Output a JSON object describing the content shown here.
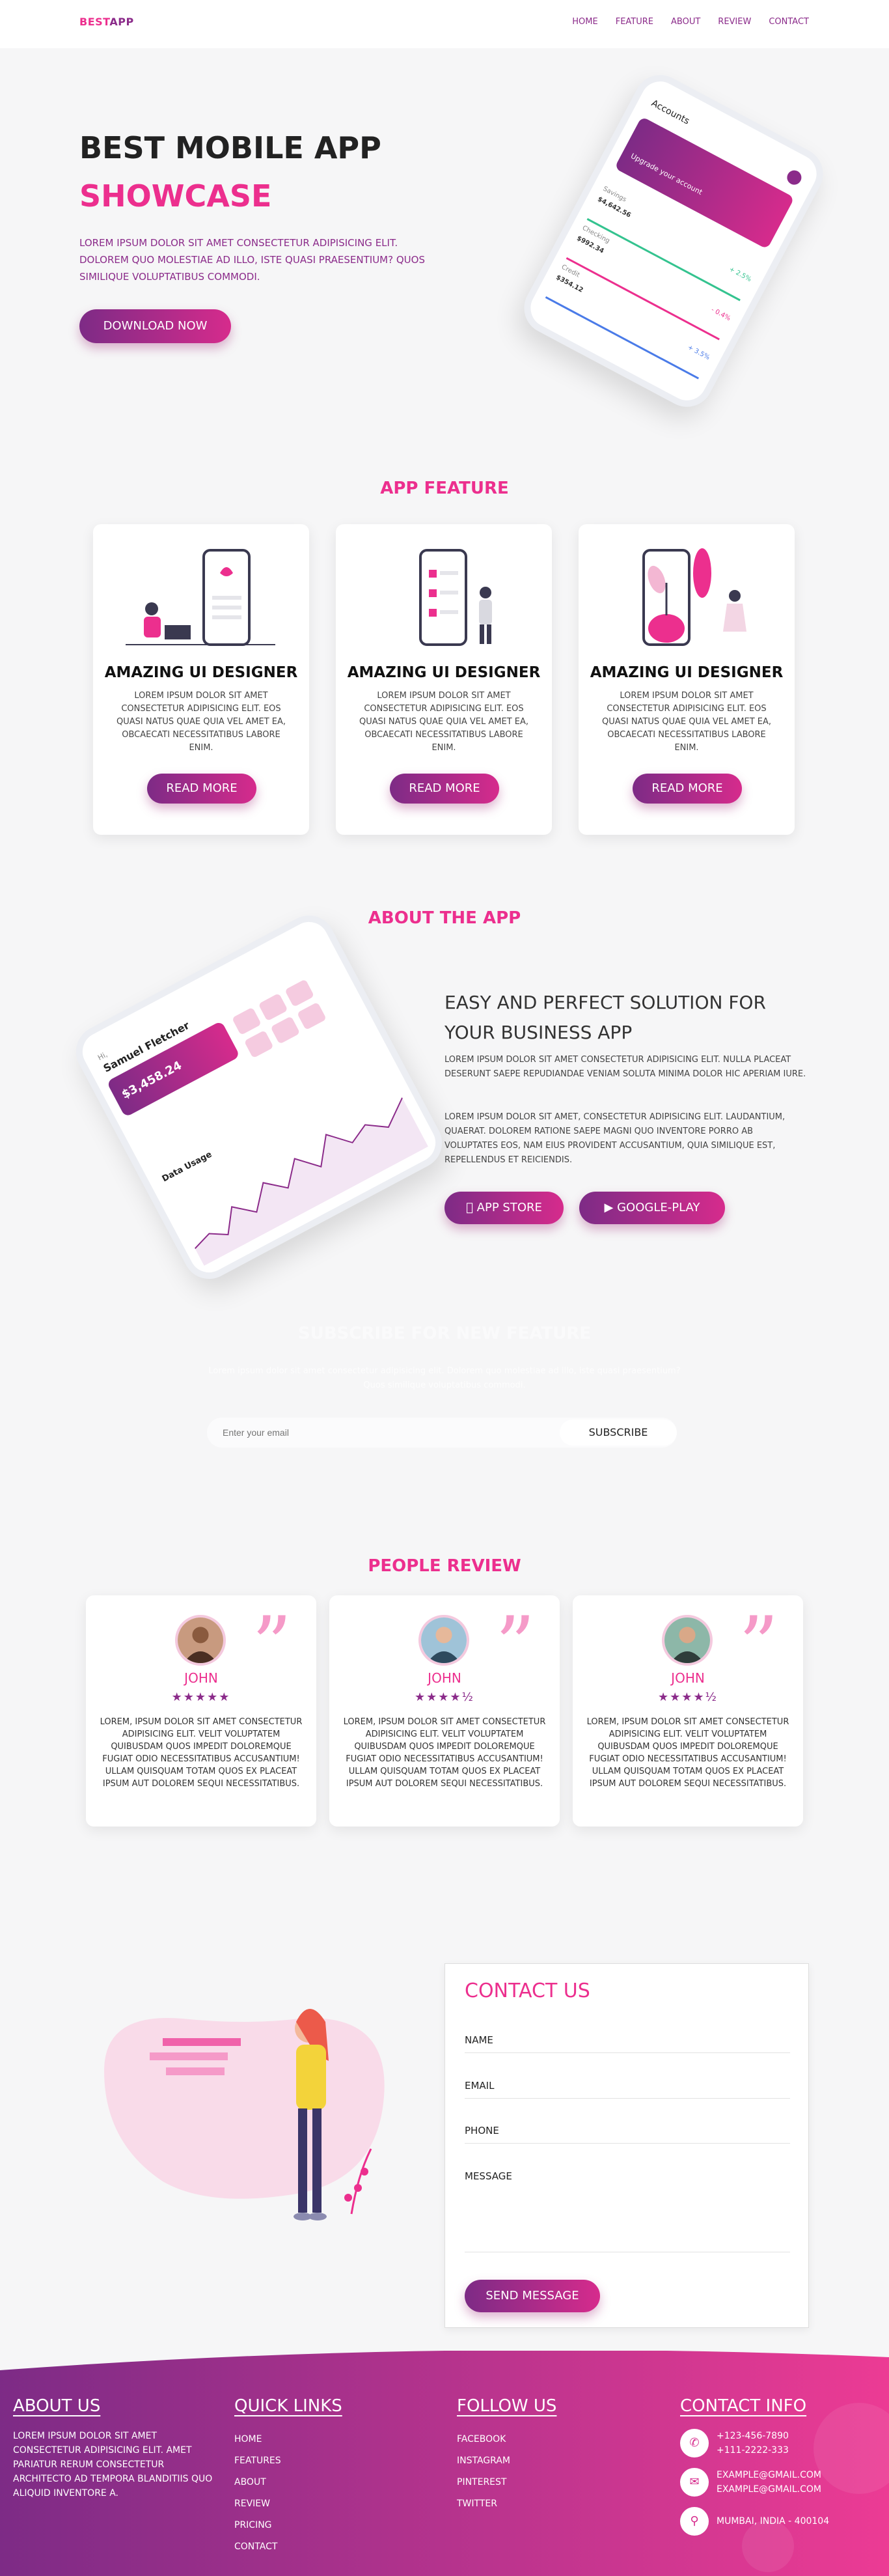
{
  "header": {
    "logo_a": "BEST",
    "logo_b": "APP",
    "nav": [
      "HOME",
      "FEATURE",
      "ABOUT",
      "REVIEW",
      "CONTACT"
    ]
  },
  "hero": {
    "title1": "BEST MOBILE APP",
    "title2": "SHOWCASE",
    "text": "Lorem ipsum dolor sit amet consectetur adipisicing elit. Dolorem quo molestiae ad illo, iste quasi praesentium? Quos similique voluptatibus commodi.",
    "button": "DOWNLOAD NOW",
    "phone": {
      "heading": "Accounts",
      "card": "Upgrade your account",
      "rows": [
        {
          "label": "Savings",
          "value": "$4,642.56",
          "delta": "+ 2.5%"
        },
        {
          "label": "Checking",
          "value": "$992.34",
          "delta": "- 0.4%"
        },
        {
          "label": "Credit",
          "value": "$354.12",
          "delta": "+ 3.5%"
        }
      ]
    }
  },
  "features": {
    "title": "APP FEATURE",
    "cards": [
      {
        "title": "AMAZING UI DESIGNER",
        "text": "Lorem ipsum dolor sit amet consectetur adipisicing elit. Eos quasi natus quae quia vel amet ea, obcaecati necessitatibus labore enim.",
        "button": "READ MORE"
      },
      {
        "title": "AMAZING UI DESIGNER",
        "text": "Lorem ipsum dolor sit amet consectetur adipisicing elit. Eos quasi natus quae quia vel amet ea, obcaecati necessitatibus labore enim.",
        "button": "READ MORE"
      },
      {
        "title": "AMAZING UI DESIGNER",
        "text": "Lorem ipsum dolor sit amet consectetur adipisicing elit. Eos quasi natus quae quia vel amet ea, obcaecati necessitatibus labore enim.",
        "button": "READ MORE"
      }
    ]
  },
  "about": {
    "title": "ABOUT THE APP",
    "heading": "EASY AND PERFECT SOLUTION FOR YOUR BUSINESS APP",
    "p1": "Lorem ipsum dolor sit amet consectetur adipisicing elit. Nulla placeat deserunt saepe repudiandae veniam soluta minima dolor hic aperiam iure.",
    "p2": "Lorem ipsum dolor sit amet, consectetur adipisicing elit. Laudantium, quaerat. Dolorem ratione saepe magni quo inventore porro ab voluptates eos, nam eius provident accusantium, quia similique est, repellendus et reiciendis.",
    "appstore": "APP STORE",
    "gplay": "GOOGLE-PLAY",
    "phone": {
      "greet": "Hi,",
      "name": "Samuel Fletcher",
      "balance": "$3,458.24",
      "chart": "Data Usage"
    }
  },
  "subscribe": {
    "title": "SUBSCRIBE FOR NEW FEATURE",
    "text": "Lorem ipsum dolor sit amet consectetur adipisicing elit. Dolorem quo molestiae ad illo, iste quasi praesentium? Quos similique voluptatibus commodi.",
    "placeholder": "Enter your email",
    "button": "SUBSCRIBE"
  },
  "review": {
    "title": "PEOPLE REVIEW",
    "cards": [
      {
        "name": "JOHN",
        "stars": "★★★★★",
        "text": "Lorem, ipsum dolor sit amet consectetur adipisicing elit. Velit voluptatem quibusdam quos impedit doloremque fugiat odio necessitatibus accusantium! Ullam quisquam totam quos ex placeat ipsum aut dolorem sequi necessitatibus."
      },
      {
        "name": "JOHN",
        "stars": "★★★★½",
        "text": "Lorem, ipsum dolor sit amet consectetur adipisicing elit. Velit voluptatem quibusdam quos impedit doloremque fugiat odio necessitatibus accusantium! Ullam quisquam totam quos ex placeat ipsum aut dolorem sequi necessitatibus."
      },
      {
        "name": "JOHN",
        "stars": "★★★★½",
        "text": "Lorem, ipsum dolor sit amet consectetur adipisicing elit. Velit voluptatem quibusdam quos impedit doloremque fugiat odio necessitatibus accusantium! Ullam quisquam totam quos ex placeat ipsum aut dolorem sequi necessitatibus."
      }
    ]
  },
  "contact": {
    "title": "CONTACT US",
    "fields": [
      "NAME",
      "EMAIL",
      "PHONE",
      "MESSAGE"
    ],
    "button": "SEND MESSAGE"
  },
  "footer": {
    "about": {
      "title": "ABOUT US",
      "text": "Lorem ipsum dolor sit amet consectetur adipisicing elit. Amet pariatur rerum consectetur architecto ad tempora blanditiis quo aliquid inventore a."
    },
    "quick": {
      "title": "QUICK LINKS",
      "links": [
        "HOME",
        "FEATURES",
        "ABOUT",
        "REVIEW",
        "PRICING",
        "CONTACT"
      ]
    },
    "follow": {
      "title": "FOLLOW US",
      "links": [
        "FACEBOOK",
        "INSTAGRAM",
        "PINTEREST",
        "TWITTER"
      ]
    },
    "info": {
      "title": "CONTACT INFO",
      "phone1": "+123-456-7890",
      "phone2": "+111-2222-333",
      "email1": "example@gmail.com",
      "email2": "example@gmail.com",
      "address": "Mumbai, India - 400104"
    }
  },
  "colors": {
    "accent": "#ec2f8e",
    "purple": "#8b2b8a",
    "bg": "#f6f6f7"
  }
}
